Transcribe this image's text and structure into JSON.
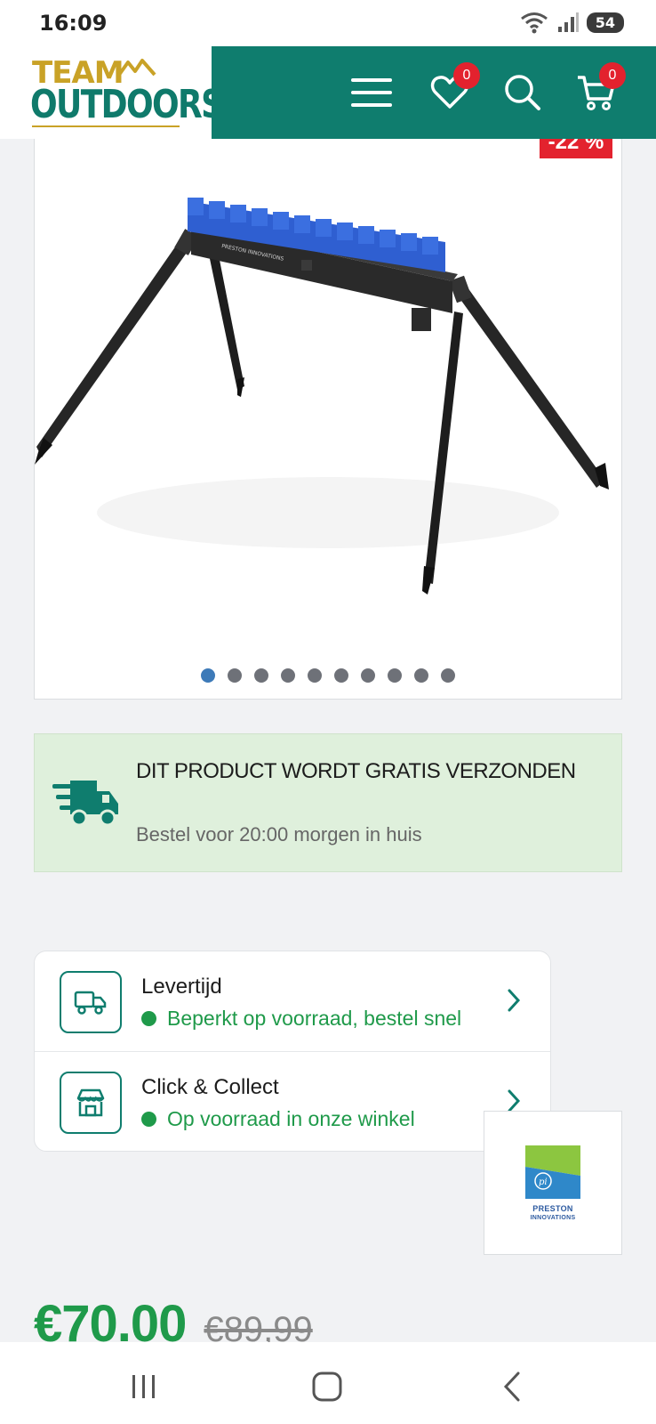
{
  "status_bar": {
    "time": "16:09",
    "battery": "54"
  },
  "header": {
    "logo_top": "TEAM",
    "logo_bottom": "OUTDOORS",
    "wishlist_count": "0",
    "cart_count": "0"
  },
  "product_image": {
    "discount_badge": "-22 %",
    "brand_label_on_product": "PRESTON INNOVATIONS",
    "carousel_total": 10,
    "carousel_active_index": 0
  },
  "shipping": {
    "title": "DIT PRODUCT WORDT GRATIS VERZONDEN",
    "subtitle": "Bestel voor 20:00 morgen in huis"
  },
  "delivery": {
    "rows": [
      {
        "title": "Levertijd",
        "status": "Beperkt op voorraad, bestel snel",
        "icon": "truck-icon"
      },
      {
        "title": "Click & Collect",
        "status": "Op voorraad in onze winkel",
        "icon": "store-icon"
      }
    ]
  },
  "brand": {
    "name_line1": "PRESTON",
    "name_line2": "INNOVATIONS"
  },
  "price": {
    "current": "€70.00",
    "old": "€89,99"
  },
  "colors": {
    "brand_teal": "#0f7d6e",
    "brand_gold": "#c9a227",
    "sale_red": "#e3222e",
    "stock_green": "#1f9a4a",
    "shipping_bg": "#dff0dc"
  }
}
